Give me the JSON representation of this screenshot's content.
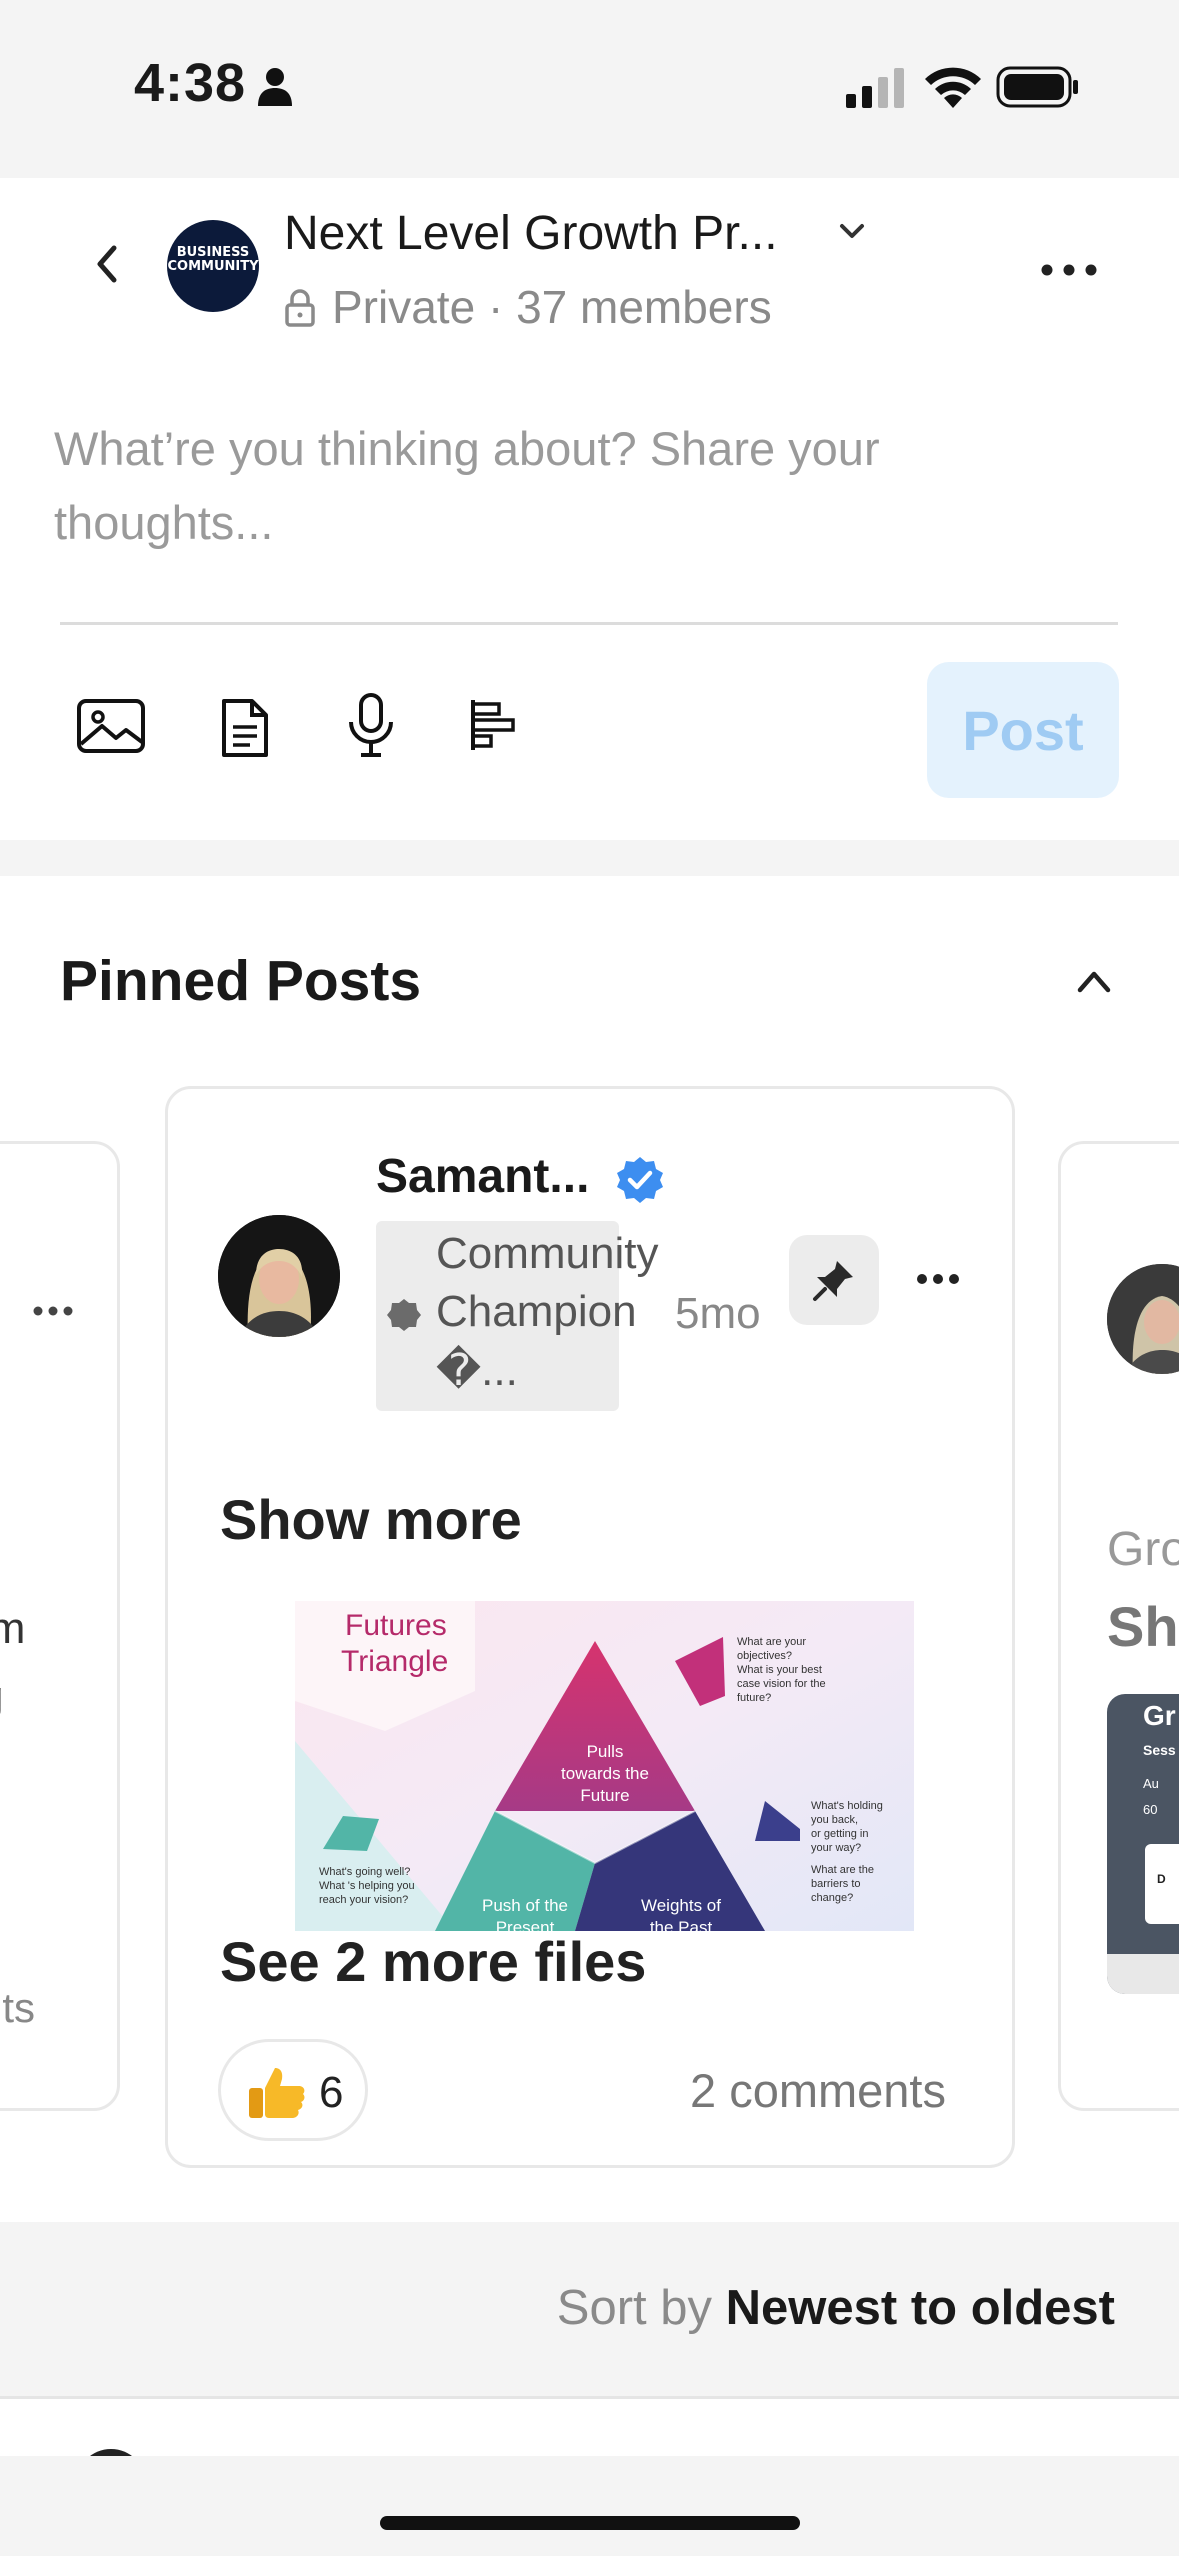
{
  "status_bar": {
    "time": "4:38",
    "icons": [
      "person-icon",
      "signal-icon",
      "wifi-icon",
      "battery-icon"
    ]
  },
  "header": {
    "group_logo_text": "BUSINESS COMMUNITY",
    "group_name": "Next Level Growth Pr...",
    "privacy": "Private",
    "separator": "·",
    "members": "37 members",
    "icons": [
      "back-icon",
      "chevron-down-icon",
      "lock-icon",
      "more-icon"
    ]
  },
  "composer": {
    "placeholder": "What’re you thinking about? Share your thoughts...",
    "tools": [
      "image-icon",
      "document-icon",
      "microphone-icon",
      "poll-icon"
    ],
    "post_label": "Post"
  },
  "pinned": {
    "title": "Pinned Posts",
    "left_card": {
      "fragment1": "’m",
      "fragment2": "g",
      "fragment3": "nts"
    },
    "main_card": {
      "author": "Samant...",
      "badge_line1": "Community",
      "badge_line2": "Champion",
      "badge_line3": "�...",
      "time": "5mo",
      "show_more": "Show more",
      "image": {
        "title_line1": "Futures",
        "title_line2": "Triangle",
        "center_l1": "Pulls",
        "center_l2": "towards the",
        "center_l3": "Future",
        "q1_l1": "What are your",
        "q1_l2": "objectives?",
        "q1_l3": "What is your best",
        "q1_l4": "case vision for the",
        "q1_l5": "future?",
        "q2_l1": "What's holding",
        "q2_l2": "you back,",
        "q2_l3": "or getting in",
        "q2_l4": "your way?",
        "q2_l5": "What are the",
        "q2_l6": "barriers to",
        "q2_l7": "change?",
        "q3_l1": "What's going well?",
        "q3_l2": "What 's helping you",
        "q3_l3": "reach your vision?",
        "push_l1": "Push of the",
        "push_l2": "Present",
        "weights_l1": "Weights of",
        "weights_l2": "the Past"
      },
      "see_more_files": "See 2 more files",
      "reaction_count": "6",
      "comments": "2 comments"
    },
    "right_card": {
      "fragment1": "Gro",
      "fragment2": "She",
      "thumb_title": "Gr",
      "thumb_l1": "Sess",
      "thumb_l2": "Au",
      "thumb_l3": "60",
      "thumb_btn": "D"
    }
  },
  "sort": {
    "prefix": "Sort by",
    "value": "Newest to oldest"
  }
}
